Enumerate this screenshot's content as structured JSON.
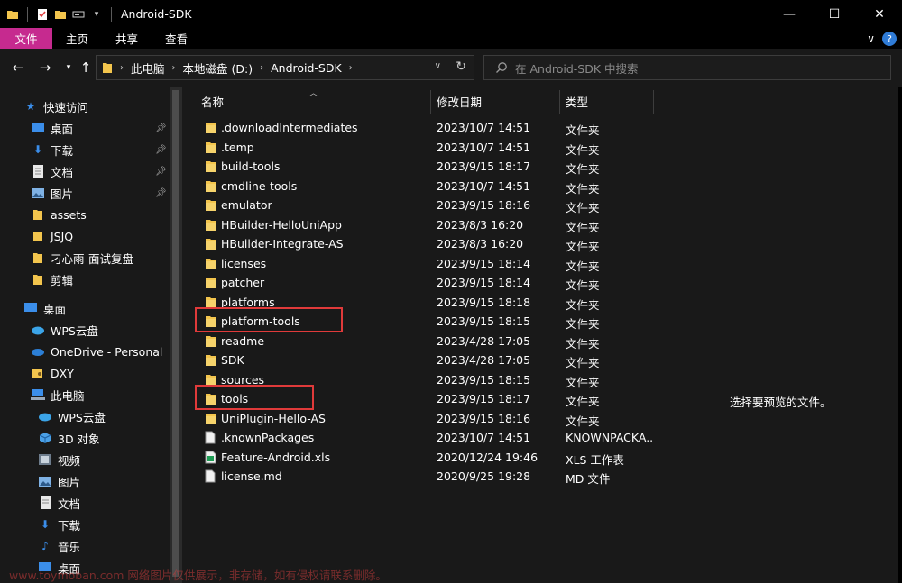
{
  "window": {
    "title": "Android-SDK"
  },
  "ribbon": {
    "tabs": [
      "文件",
      "主页",
      "共享",
      "查看"
    ]
  },
  "address": {
    "crumbs": [
      "此电脑",
      "本地磁盘 (D:)",
      "Android-SDK"
    ]
  },
  "search": {
    "placeholder": "在 Android-SDK 中搜索"
  },
  "nav": {
    "quick_access": "快速访问",
    "items": [
      {
        "label": "桌面",
        "icon": "desktop-icon",
        "pinned": true
      },
      {
        "label": "下载",
        "icon": "download-icon",
        "pinned": true
      },
      {
        "label": "文档",
        "icon": "document-icon",
        "pinned": true
      },
      {
        "label": "图片",
        "icon": "picture-icon",
        "pinned": true
      },
      {
        "label": "assets",
        "icon": "folder-icon"
      },
      {
        "label": "JSJQ",
        "icon": "folder-icon"
      },
      {
        "label": "刁心雨-面试复盘",
        "icon": "folder-icon"
      },
      {
        "label": "剪辑",
        "icon": "folder-icon"
      }
    ],
    "desktop": "桌面",
    "wps_cloud": "WPS云盘",
    "onedrive": "OneDrive - Personal",
    "dxy": "DXY",
    "this_pc": "此电脑",
    "pc_items": [
      "WPS云盘",
      "3D 对象",
      "视频",
      "图片",
      "文档",
      "下载",
      "音乐",
      "桌面"
    ]
  },
  "columns": {
    "name": "名称",
    "date": "修改日期",
    "type": "类型"
  },
  "files": [
    {
      "name": ".downloadIntermediates",
      "date": "2023/10/7 14:51",
      "type": "文件夹",
      "kind": "folder"
    },
    {
      "name": ".temp",
      "date": "2023/10/7 14:51",
      "type": "文件夹",
      "kind": "folder"
    },
    {
      "name": "build-tools",
      "date": "2023/9/15 18:17",
      "type": "文件夹",
      "kind": "folder"
    },
    {
      "name": "cmdline-tools",
      "date": "2023/10/7 14:51",
      "type": "文件夹",
      "kind": "folder"
    },
    {
      "name": "emulator",
      "date": "2023/9/15 18:16",
      "type": "文件夹",
      "kind": "folder"
    },
    {
      "name": "HBuilder-HelloUniApp",
      "date": "2023/8/3 16:20",
      "type": "文件夹",
      "kind": "folder"
    },
    {
      "name": "HBuilder-Integrate-AS",
      "date": "2023/8/3 16:20",
      "type": "文件夹",
      "kind": "folder"
    },
    {
      "name": "licenses",
      "date": "2023/9/15 18:14",
      "type": "文件夹",
      "kind": "folder"
    },
    {
      "name": "patcher",
      "date": "2023/9/15 18:14",
      "type": "文件夹",
      "kind": "folder"
    },
    {
      "name": "platforms",
      "date": "2023/9/15 18:18",
      "type": "文件夹",
      "kind": "folder"
    },
    {
      "name": "platform-tools",
      "date": "2023/9/15 18:15",
      "type": "文件夹",
      "kind": "folder",
      "highlight": true
    },
    {
      "name": "readme",
      "date": "2023/4/28 17:05",
      "type": "文件夹",
      "kind": "folder"
    },
    {
      "name": "SDK",
      "date": "2023/4/28 17:05",
      "type": "文件夹",
      "kind": "folder"
    },
    {
      "name": "sources",
      "date": "2023/9/15 18:15",
      "type": "文件夹",
      "kind": "folder"
    },
    {
      "name": "tools",
      "date": "2023/9/15 18:17",
      "type": "文件夹",
      "kind": "folder",
      "highlight": true
    },
    {
      "name": "UniPlugin-Hello-AS",
      "date": "2023/9/15 18:16",
      "type": "文件夹",
      "kind": "folder"
    },
    {
      "name": ".knownPackages",
      "date": "2023/10/7 14:51",
      "type": "KNOWNPACKA...",
      "kind": "file"
    },
    {
      "name": "Feature-Android.xls",
      "date": "2020/12/24 19:46",
      "type": "XLS 工作表",
      "kind": "xls"
    },
    {
      "name": "license.md",
      "date": "2020/9/25 19:28",
      "type": "MD 文件",
      "kind": "file"
    }
  ],
  "preview": {
    "text": "选择要预览的文件。"
  },
  "watermark": "www.toymoban.com 网络图片仅供展示，非存储，如有侵权请联系删除。",
  "colors": {
    "file_tab": "#c62a8f",
    "folder": "#f3c54d",
    "highlight_box": "#e03a3a",
    "background": "#191919"
  }
}
